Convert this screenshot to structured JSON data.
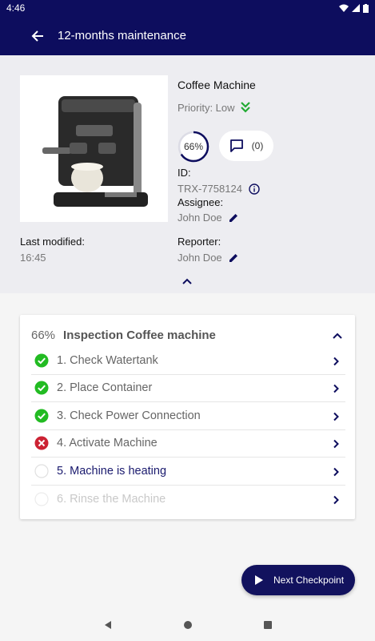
{
  "status_bar": {
    "time": "4:46"
  },
  "app_bar": {
    "title": "12-months maintenance"
  },
  "machine": {
    "name": "Coffee Machine",
    "priority": "Priority: Low",
    "progress": "66%",
    "progress_fraction": 0.66,
    "comments": "(0)"
  },
  "details": {
    "id_label": "ID:",
    "id_value": "TRX-7758124",
    "assignee_label": "Assignee:",
    "assignee_value": "John Doe",
    "reporter_label": "Reporter:",
    "reporter_value": "John Doe",
    "modified_label": "Last modified:",
    "modified_value": "16:45"
  },
  "inspection": {
    "percent": "66%",
    "title": "Inspection Coffee machine",
    "tasks": [
      {
        "label": "1. Check Watertank",
        "status": "done"
      },
      {
        "label": "2. Place Container",
        "status": "done"
      },
      {
        "label": "3. Check Power Connection",
        "status": "done"
      },
      {
        "label": "4. Activate Machine",
        "status": "failed"
      },
      {
        "label": "5. Machine is heating",
        "status": "current"
      },
      {
        "label": "6. Rinse the Machine",
        "status": "disabled"
      }
    ]
  },
  "fab": {
    "label": "Next Checkpoint"
  },
  "colors": {
    "primary": "#0d0d5e",
    "success": "#22bb22",
    "error": "#cc2233",
    "priority_low": "#22aa33"
  }
}
